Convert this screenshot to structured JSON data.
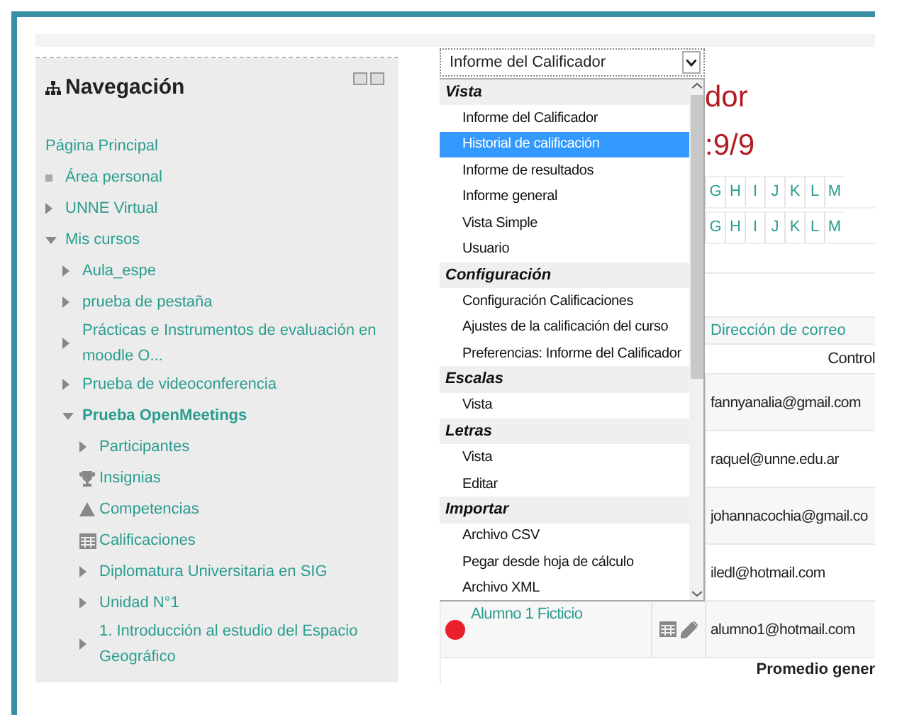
{
  "navigation": {
    "title": "Navegación",
    "items": [
      {
        "label": "Página Principal",
        "kind": "plain",
        "current": false
      },
      {
        "label": "Área personal",
        "kind": "bullet",
        "current": false
      },
      {
        "label": "UNNE Virtual",
        "kind": "branch",
        "expanded": false,
        "current": false
      },
      {
        "label": "Mis cursos",
        "kind": "branch",
        "expanded": true,
        "current": false,
        "children": [
          {
            "label": "Aula_espe",
            "kind": "branch",
            "expanded": false,
            "current": false
          },
          {
            "label": "prueba de pestaña",
            "kind": "branch",
            "expanded": false,
            "current": false
          },
          {
            "label": "Prácticas e Instrumentos de evaluación en moodle O...",
            "kind": "branch",
            "expanded": false,
            "current": false
          },
          {
            "label": "Prueba de videoconferencia",
            "kind": "branch",
            "expanded": false,
            "current": false
          },
          {
            "label": "Prueba OpenMeetings",
            "kind": "branch",
            "expanded": true,
            "current": true,
            "children": [
              {
                "label": "Participantes",
                "kind": "branch",
                "expanded": false,
                "current": false
              },
              {
                "label": "Insignias",
                "kind": "trophy",
                "current": false
              },
              {
                "label": "Competencias",
                "kind": "pyramid",
                "current": false
              },
              {
                "label": "Calificaciones",
                "kind": "table",
                "current": false
              },
              {
                "label": "Diplomatura Universitaria en SIG",
                "kind": "branch",
                "expanded": false,
                "current": false
              },
              {
                "label": "Unidad N°1",
                "kind": "branch",
                "expanded": false,
                "current": false
              },
              {
                "label": "1. Introducción al estudio del Espacio Geográfico",
                "kind": "branch",
                "expanded": false,
                "current": false
              }
            ]
          }
        ]
      }
    ]
  },
  "report_select": {
    "value": "Informe del Calificador",
    "groups": [
      {
        "label": "Vista",
        "options": [
          {
            "label": "Informe del Calificador",
            "selected": false
          },
          {
            "label": "Historial de calificación",
            "selected": true
          },
          {
            "label": "Informe de resultados",
            "selected": false
          },
          {
            "label": "Informe general",
            "selected": false
          },
          {
            "label": "Vista Simple",
            "selected": false
          },
          {
            "label": "Usuario",
            "selected": false
          }
        ]
      },
      {
        "label": "Configuración",
        "options": [
          {
            "label": "Configuración Calificaciones",
            "selected": false
          },
          {
            "label": "Ajustes de la calificación del curso",
            "selected": false
          },
          {
            "label": "Preferencias: Informe del Calificador",
            "selected": false
          }
        ]
      },
      {
        "label": "Escalas",
        "options": [
          {
            "label": "Vista",
            "selected": false
          }
        ]
      },
      {
        "label": "Letras",
        "options": [
          {
            "label": "Vista",
            "selected": false
          },
          {
            "label": "Editar",
            "selected": false
          }
        ]
      },
      {
        "label": "Importar",
        "options": [
          {
            "label": "Archivo CSV",
            "selected": false
          },
          {
            "label": "Pegar desde hoja de cálculo",
            "selected": false
          },
          {
            "label": "Archivo XML",
            "selected": false
          }
        ]
      }
    ]
  },
  "heading": "dor",
  "subheading": ":9/9",
  "letter_filters": [
    [
      "G",
      "H",
      "I",
      "J",
      "K",
      "L",
      "M"
    ],
    [
      "G",
      "H",
      "I",
      "J",
      "K",
      "L",
      "M"
    ]
  ],
  "table": {
    "email_header": "Dirección de correo",
    "column_3": "Control",
    "rows": [
      {
        "email": "fannyanalia@gmail.com"
      },
      {
        "email": "raquel@unne.edu.ar"
      },
      {
        "email": "johannacochia@gmail.co"
      },
      {
        "email": "iledl@hotmail.com"
      },
      {
        "name": "Alumno 1 Ficticio",
        "email": "alumno1@hotmail.com"
      }
    ],
    "footer": "Promedio gener"
  }
}
